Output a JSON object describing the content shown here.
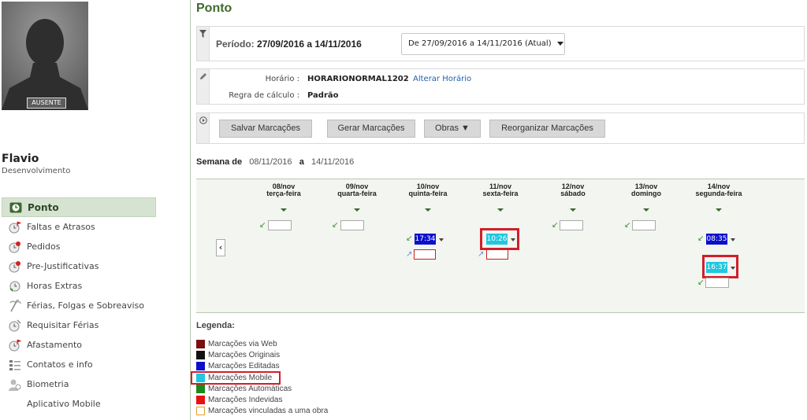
{
  "user": {
    "status": "AUSENTE",
    "name": "Flavio",
    "department": "Desenvolvimento"
  },
  "nav": [
    {
      "label": "Ponto",
      "icon": "clock-icon",
      "active": true
    },
    {
      "label": "Faltas e Atrasos",
      "icon": "clock-flag-icon"
    },
    {
      "label": "Pedidos",
      "icon": "clock-request-icon"
    },
    {
      "label": "Pre-Justificativas",
      "icon": "clock-justify-icon"
    },
    {
      "label": "Horas Extras",
      "icon": "clock-plus-icon"
    },
    {
      "label": "Férias, Folgas e Sobreaviso",
      "icon": "palm-icon"
    },
    {
      "label": "Requisitar Férias",
      "icon": "clock-vacation-icon"
    },
    {
      "label": "Afastamento",
      "icon": "clock-absence-icon"
    },
    {
      "label": "Contatos e info",
      "icon": "contacts-icon"
    },
    {
      "label": "Biometria",
      "icon": "biometry-icon"
    },
    {
      "label": "Aplicativo Mobile",
      "icon": ""
    }
  ],
  "page": {
    "title": "Ponto"
  },
  "period": {
    "label": "Período:",
    "value": "27/09/2016 a 14/11/2016",
    "select": "De 27/09/2016 a 14/11/2016 (Atual)"
  },
  "schedule": {
    "horario_label": "Horário :",
    "horario_value": "HORARIONORMAL1202",
    "change_link": "Alterar Horário",
    "rule_label": "Regra de cálculo :",
    "rule_value": "Padrão"
  },
  "actions": {
    "save": "Salvar Marcações",
    "generate": "Gerar Marcações",
    "works": "Obras ▼",
    "reorganize": "Reorganizar Marcações"
  },
  "week": {
    "label": "Semana de",
    "start": "08/11/2016",
    "sep": "a",
    "end": "14/11/2016"
  },
  "days": [
    {
      "date": "08/nov",
      "weekday": "terça-feira"
    },
    {
      "date": "09/nov",
      "weekday": "quarta-feira"
    },
    {
      "date": "10/nov",
      "weekday": "quinta-feira"
    },
    {
      "date": "11/nov",
      "weekday": "sexta-feira"
    },
    {
      "date": "12/nov",
      "weekday": "sábado"
    },
    {
      "date": "13/nov",
      "weekday": "domingo"
    },
    {
      "date": "14/nov",
      "weekday": "segunda-feira"
    }
  ],
  "marks": {
    "thu_in": "17:34",
    "fri_in": "10:26",
    "mon_in": "08:35",
    "mon_out": "16:37"
  },
  "legend": {
    "title": "Legenda:",
    "items": [
      {
        "label": "Marcações via Web",
        "color": "#7a1010"
      },
      {
        "label": "Marcações Originais",
        "color": "#111111"
      },
      {
        "label": "Marcações Editadas",
        "color": "#0a10cc"
      },
      {
        "label": "Marcações Mobile",
        "color": "#1ec8e0"
      },
      {
        "label": "Marcações Automáticas",
        "color": "#1a8a1a"
      },
      {
        "label": "Marcações Indevidas",
        "color": "#e81010"
      },
      {
        "label": "Marcações vinculadas a uma obra",
        "color": "#ffffff"
      }
    ]
  }
}
